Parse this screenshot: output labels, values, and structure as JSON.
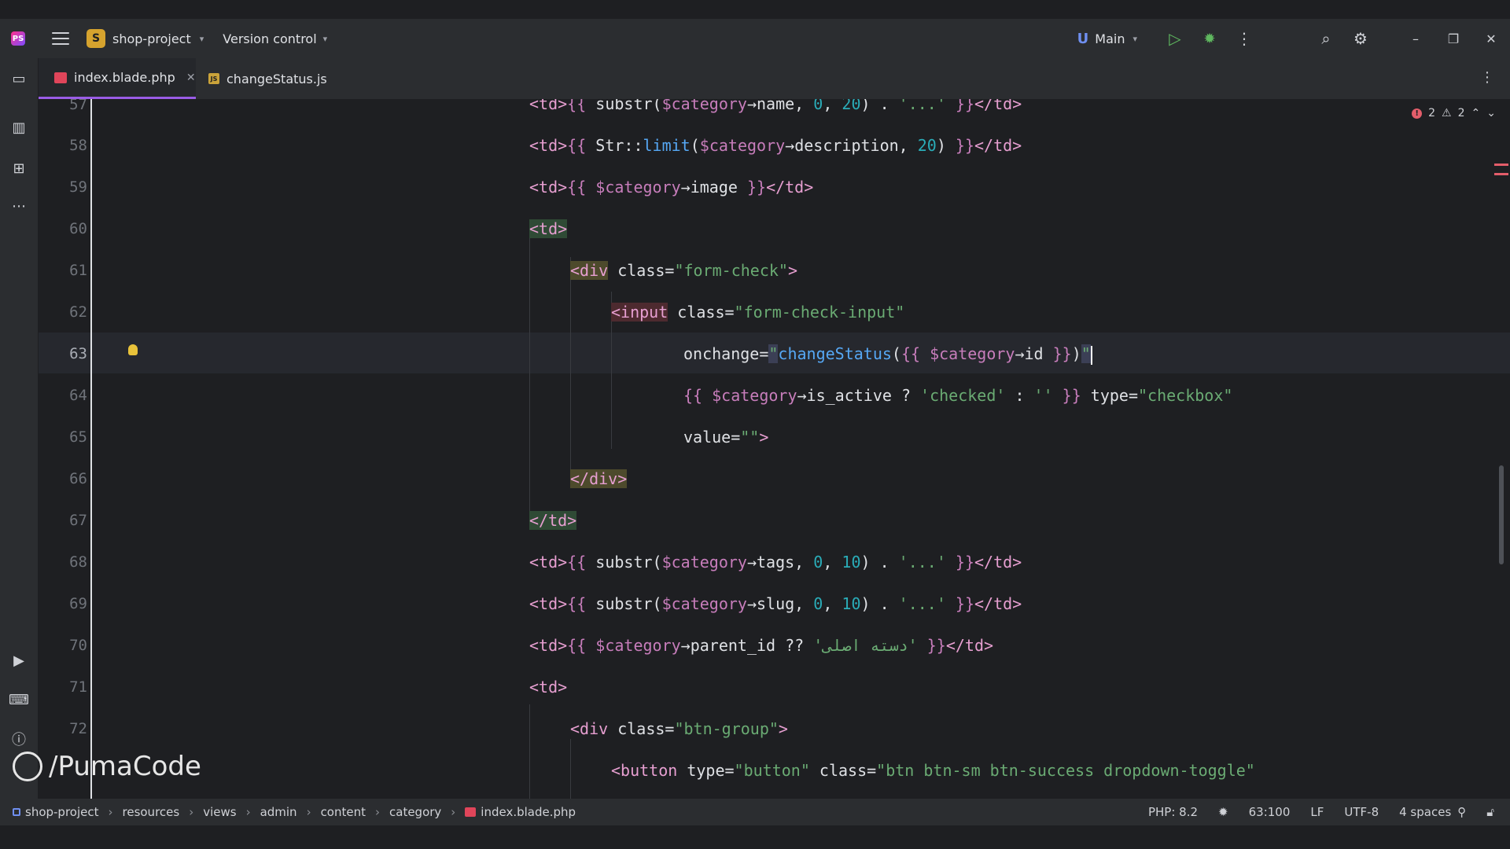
{
  "titlebar": {
    "project_badge": "S",
    "project_name": "shop-project",
    "version_control": "Version control",
    "branch": "Main",
    "icons": [
      "app-logo",
      "hamburger-icon",
      "branch-icon",
      "run-icon",
      "debug-icon",
      "more-icon",
      "search-icon",
      "settings-icon",
      "minimize-icon",
      "maximize-icon",
      "close-icon"
    ]
  },
  "tabs": [
    {
      "label": "index.blade.php",
      "active": true
    },
    {
      "label": "changeStatus.js",
      "active": false
    }
  ],
  "inspections": {
    "errors": "2",
    "warnings": "2"
  },
  "line_numbers": [
    "57",
    "58",
    "59",
    "60",
    "61",
    "62",
    "63",
    "64",
    "65",
    "66",
    "67",
    "68",
    "69",
    "70",
    "71",
    "72",
    ""
  ],
  "code": {
    "l57": [
      "<td>",
      "{{ ",
      "substr(",
      "$category",
      "→name, ",
      "0",
      ", ",
      "20",
      ") . ",
      "'...'",
      " }}",
      "</td>"
    ],
    "l58": [
      "<td>",
      "{{ ",
      "Str::",
      "limit",
      "(",
      "$category",
      "→description, ",
      "20",
      ") ",
      "}}",
      "</td>"
    ],
    "l59": [
      "<td>",
      "{{ ",
      "$category",
      "→image ",
      "}}",
      "</td>"
    ],
    "l60": [
      "<td>"
    ],
    "l61": [
      "<div",
      " class=",
      "\"form-check\"",
      ">"
    ],
    "l62": [
      "<input",
      " class=",
      "\"form-check-input\""
    ],
    "l63": [
      "onchange=",
      "\"",
      "changeStatus",
      "(",
      "{{ ",
      "$category",
      "→id ",
      "}}",
      ")",
      "\""
    ],
    "l64": [
      "{{ ",
      "$category",
      "→is_active ? ",
      "'checked'",
      " : ",
      "''",
      " }}",
      " type=",
      "\"checkbox\""
    ],
    "l65": [
      "value=",
      "\"\"",
      ">"
    ],
    "l66": [
      "</div>"
    ],
    "l67": [
      "</td>"
    ],
    "l68": [
      "<td>",
      "{{ ",
      "substr(",
      "$category",
      "→tags, ",
      "0",
      ", ",
      "10",
      ") . ",
      "'...'",
      " }}",
      "</td>"
    ],
    "l69": [
      "<td>",
      "{{ ",
      "substr(",
      "$category",
      "→slug, ",
      "0",
      ", ",
      "10",
      ") . ",
      "'...'",
      " }}",
      "</td>"
    ],
    "l70": [
      "<td>",
      "{{ ",
      "$category",
      "→parent_id ?? ",
      "'دسته اصلی'",
      " }}",
      "</td>"
    ],
    "l71": [
      "<td>"
    ],
    "l72": [
      "<div",
      " class=",
      "\"btn-group\"",
      ">"
    ],
    "l73": [
      "<button",
      " type=",
      "\"button\"",
      " class=",
      "\"btn btn-sm btn-success dropdown-toggle\""
    ]
  },
  "watermark": "/PumaCode",
  "breadcrumb": [
    "shop-project",
    "resources",
    "views",
    "admin",
    "content",
    "category",
    "index.blade.php"
  ],
  "status": {
    "php": "PHP: 8.2",
    "position": "63:100",
    "line_sep": "LF",
    "encoding": "UTF-8",
    "indent": "4 spaces"
  },
  "colors": {
    "background": "#1e1f22",
    "panel": "#2b2d30",
    "tag": "#e79fd1",
    "string": "#6aab73",
    "number": "#2aacb8",
    "function": "#56a8f5",
    "accent": "#9a5ce6"
  }
}
